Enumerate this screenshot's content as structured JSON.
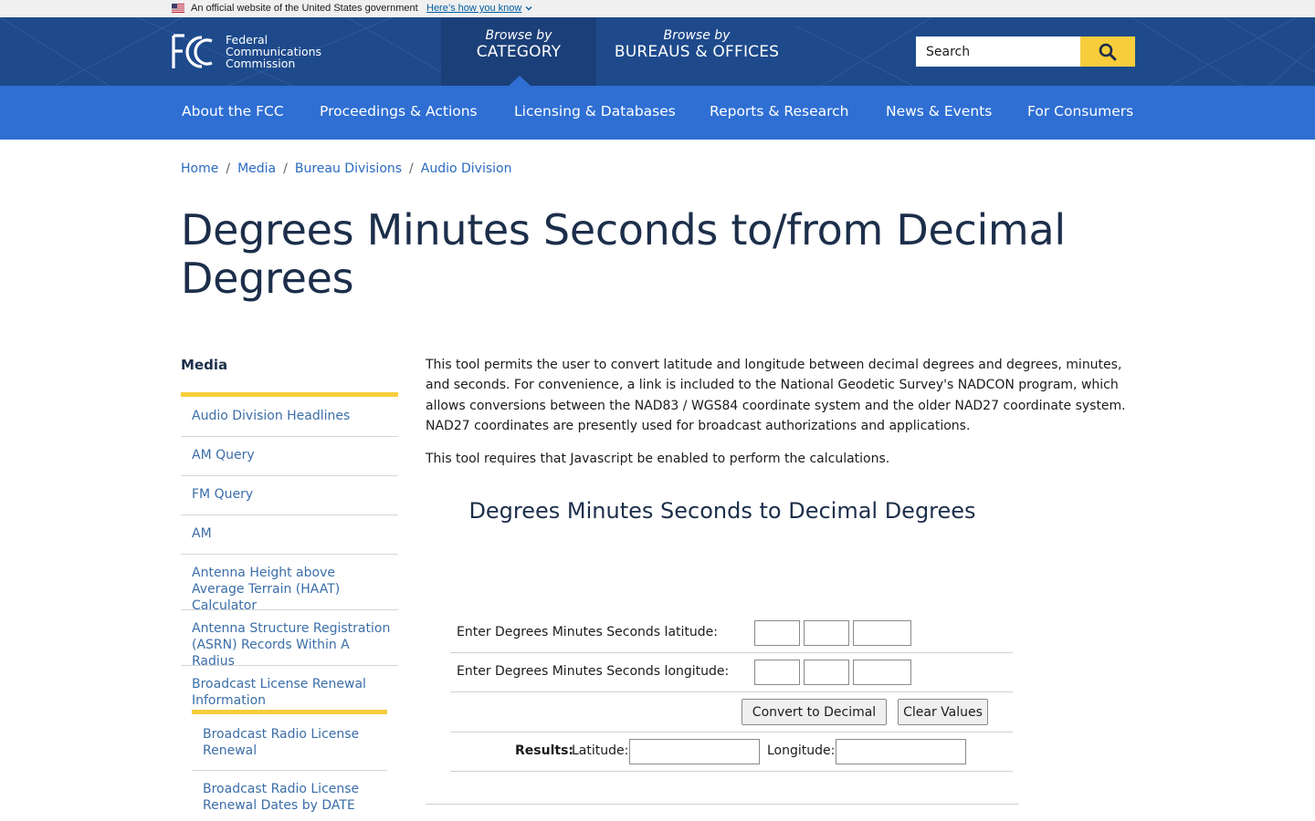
{
  "gov_banner": {
    "text": "An official website of the United States government",
    "link": "Here’s how you know"
  },
  "header": {
    "logo": {
      "mark": "FCC",
      "line1": "Federal",
      "line2": "Communications",
      "line3": "Commission"
    },
    "browse_category": {
      "small": "Browse by",
      "big": "CATEGORY"
    },
    "browse_bureaus": {
      "small": "Browse by",
      "big": "BUREAUS & OFFICES"
    },
    "search": {
      "value": "Search",
      "icon": "search-icon"
    },
    "colors": {
      "header_bg": "#1e4a8c",
      "nav_bg": "#2f6fd3",
      "accent": "#f7cd3b"
    }
  },
  "mainnav": {
    "items": [
      "About the FCC",
      "Proceedings & Actions",
      "Licensing & Databases",
      "Reports & Research",
      "News & Events",
      "For Consumers"
    ]
  },
  "breadcrumb": [
    "Home",
    "Media",
    "Bureau Divisions",
    "Audio Division"
  ],
  "page": {
    "title": "Degrees Minutes Seconds to/from Decimal Degrees"
  },
  "sidebar": {
    "title": "Media",
    "items": [
      "Audio Division Headlines",
      "AM Query",
      "FM Query",
      "AM",
      "Antenna Height above Average Terrain (HAAT) Calculator",
      "Antenna Structure Registration (ASRN) Records Within A Radius",
      "Broadcast License Renewal Information"
    ],
    "subitems": [
      "Broadcast Radio License Renewal",
      "Broadcast Radio License Renewal Dates by DATE"
    ]
  },
  "content": {
    "intro": "This tool permits the user to convert latitude and longitude between decimal degrees and degrees, minutes, and seconds.  For convenience, a link is included to the National Geodetic Survey's NADCON program, which allows conversions between the NAD83 / WGS84 coordinate system and the older NAD27 coordinate system.  NAD27 coordinates are presently used for broadcast authorizations and applications.",
    "js_note": "This tool requires that Javascript be enabled to perform the calculations."
  },
  "tool": {
    "title": "Degrees Minutes Seconds to Decimal Degrees",
    "lat_label": "Enter Degrees Minutes Seconds latitude:",
    "lon_label": "Enter Degrees Minutes Seconds longitude:",
    "lat_deg": "",
    "lat_min": "",
    "lat_sec": "",
    "lon_deg": "",
    "lon_min": "",
    "lon_sec": "",
    "convert_label": "Convert to Decimal",
    "clear_label": "Clear Values",
    "results_label": "Results:",
    "latitude_label": "Latitude:",
    "longitude_label": "Longitude:",
    "latitude_result": "",
    "longitude_result": ""
  }
}
